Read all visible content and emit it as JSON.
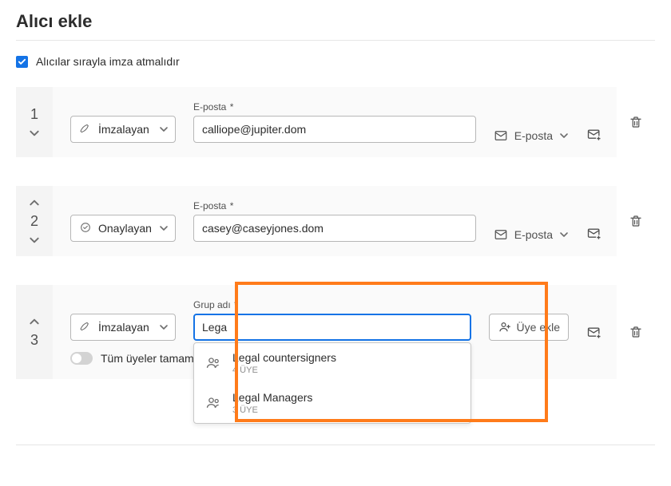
{
  "title": "Alıcı ekle",
  "orderCheckbox": {
    "checked": true,
    "label": "Alıcılar sırayla imza atmalıdır"
  },
  "fieldLabels": {
    "email": "E-posta",
    "group": "Grup adı",
    "required": "*"
  },
  "delivery": {
    "label": "E-posta"
  },
  "addMember": {
    "label": "Üye ekle"
  },
  "allComplete": {
    "label": "Tüm üyeler tamamlamalıdır"
  },
  "roles": {
    "signer": "İmzalayan",
    "approver": "Onaylayan"
  },
  "recipients": [
    {
      "seq": "1",
      "role": "signer",
      "email": "calliope@jupiter.dom",
      "showUp": false,
      "showDown": true
    },
    {
      "seq": "2",
      "role": "approver",
      "email": "casey@caseyjones.dom",
      "showUp": true,
      "showDown": true
    }
  ],
  "groupRecipient": {
    "seq": "3",
    "role": "signer",
    "groupInput": "Lega",
    "showUp": true,
    "showDown": false
  },
  "suggestions": [
    {
      "name": "Legal countersigners",
      "meta": "4 ÜYE"
    },
    {
      "name": "Legal Managers",
      "meta": "3 ÜYE"
    }
  ]
}
